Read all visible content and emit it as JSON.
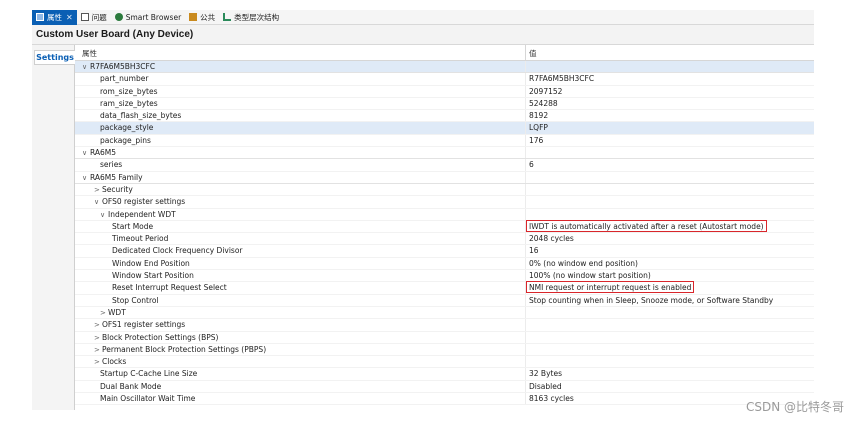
{
  "tabs": [
    {
      "label": "属性",
      "icon": "properties-icon",
      "active": true,
      "close": "✕"
    },
    {
      "label": "问题",
      "icon": "problems-icon",
      "active": false
    },
    {
      "label": "Smart Browser",
      "icon": "smart-browser-icon",
      "active": false
    },
    {
      "label": "公共",
      "icon": "common-icon",
      "active": false
    },
    {
      "label": "类型层次结构",
      "icon": "type-hierarchy-icon",
      "active": false
    }
  ],
  "title": "Custom User Board (Any Device)",
  "side_tab": "Settings",
  "columns": {
    "property": "属性",
    "value": "值"
  },
  "rows": [
    {
      "indent": 0,
      "chevron": "∨",
      "name": "R7FA6M5BH3CFC",
      "value": "",
      "category": true,
      "selected": true
    },
    {
      "indent": 3,
      "chevron": "",
      "name": "part_number",
      "value": "R7FA6M5BH3CFC"
    },
    {
      "indent": 3,
      "chevron": "",
      "name": "rom_size_bytes",
      "value": "2097152"
    },
    {
      "indent": 3,
      "chevron": "",
      "name": "ram_size_bytes",
      "value": "524288"
    },
    {
      "indent": 3,
      "chevron": "",
      "name": "data_flash_size_bytes",
      "value": "8192"
    },
    {
      "indent": 3,
      "chevron": "",
      "name": "package_style",
      "value": "LQFP",
      "selected": true
    },
    {
      "indent": 3,
      "chevron": "",
      "name": "package_pins",
      "value": "176"
    },
    {
      "indent": 0,
      "chevron": "∨",
      "name": "RA6M5",
      "value": "",
      "category": true
    },
    {
      "indent": 3,
      "chevron": "",
      "name": "series",
      "value": "6"
    },
    {
      "indent": 0,
      "chevron": "∨",
      "name": "RA6M5 Family",
      "value": "",
      "category": true
    },
    {
      "indent": 2,
      "chevron": ">",
      "name": "Security",
      "value": ""
    },
    {
      "indent": 2,
      "chevron": "∨",
      "name": "OFS0 register settings",
      "value": ""
    },
    {
      "indent": 3,
      "chevron": "∨",
      "name": "Independent WDT",
      "value": ""
    },
    {
      "indent": 5,
      "chevron": "",
      "name": "Start Mode",
      "value": "IWDT is automatically activated after a reset (Autostart mode)",
      "highlight": true
    },
    {
      "indent": 5,
      "chevron": "",
      "name": "Timeout Period",
      "value": "2048 cycles"
    },
    {
      "indent": 5,
      "chevron": "",
      "name": "Dedicated Clock Frequency Divisor",
      "value": "16"
    },
    {
      "indent": 5,
      "chevron": "",
      "name": "Window End Position",
      "value": " 0% (no window end position)"
    },
    {
      "indent": 5,
      "chevron": "",
      "name": "Window Start Position",
      "value": "100% (no window start position)"
    },
    {
      "indent": 5,
      "chevron": "",
      "name": "Reset Interrupt Request Select",
      "value": "NMI request or interrupt request is enabled",
      "highlight": true
    },
    {
      "indent": 5,
      "chevron": "",
      "name": "Stop Control",
      "value": "Stop counting when in Sleep, Snooze mode, or Software Standby"
    },
    {
      "indent": 3,
      "chevron": ">",
      "name": "WDT",
      "value": ""
    },
    {
      "indent": 2,
      "chevron": ">",
      "name": "OFS1 register settings",
      "value": ""
    },
    {
      "indent": 2,
      "chevron": ">",
      "name": "Block Protection Settings (BPS)",
      "value": ""
    },
    {
      "indent": 2,
      "chevron": ">",
      "name": "Permanent Block Protection Settings (PBPS)",
      "value": ""
    },
    {
      "indent": 2,
      "chevron": ">",
      "name": "Clocks",
      "value": ""
    },
    {
      "indent": 3,
      "chevron": "",
      "name": "Startup C-Cache Line Size",
      "value": "32 Bytes"
    },
    {
      "indent": 3,
      "chevron": "",
      "name": "Dual Bank Mode",
      "value": "Disabled"
    },
    {
      "indent": 3,
      "chevron": "",
      "name": "Main Oscillator Wait Time",
      "value": "8163 cycles"
    }
  ],
  "watermark": "CSDN @比特冬哥",
  "colors": {
    "accent": "#0a5fb4",
    "highlight_box": "#d9262b",
    "selected_row": "#dfeaf7"
  }
}
